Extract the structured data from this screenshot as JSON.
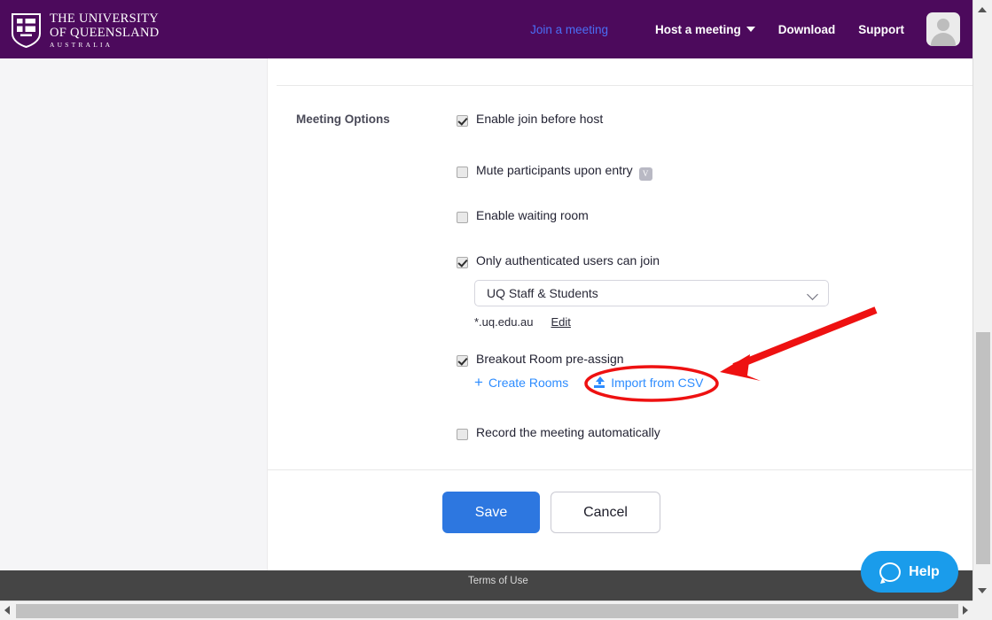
{
  "header": {
    "logo": {
      "line1": "THE UNIVERSITY",
      "line2": "OF QUEENSLAND",
      "line3": "AUSTRALIA",
      "crest_icon": "uq-crest-icon"
    },
    "nav": {
      "join": "Join a meeting",
      "host": "Host a meeting",
      "download": "Download",
      "support": "Support",
      "avatar_icon": "user-avatar-icon"
    },
    "background_color": "#4c0a5c"
  },
  "form": {
    "section_label": "Meeting Options",
    "options": [
      {
        "label": "Enable join before host",
        "checked": true
      },
      {
        "label": "Mute participants upon entry",
        "checked": false,
        "badge": "V"
      },
      {
        "label": "Enable waiting room",
        "checked": false
      },
      {
        "label": "Only authenticated users can join",
        "checked": true
      },
      {
        "label": "Breakout Room pre-assign",
        "checked": true
      },
      {
        "label": "Record the meeting automatically",
        "checked": false
      }
    ],
    "auth_select": {
      "value": "UQ Staff & Students",
      "chevron_icon": "chevron-down-icon"
    },
    "domain": {
      "value": "*.uq.edu.au",
      "edit_label": "Edit"
    },
    "breakout": {
      "create_rooms_label": "Create Rooms",
      "create_rooms_icon": "plus-icon",
      "import_csv_label": "Import from CSV",
      "import_csv_icon": "upload-icon"
    },
    "buttons": {
      "save": "Save",
      "cancel": "Cancel",
      "save_color": "#2d77e0"
    }
  },
  "footer": {
    "terms": "Terms of Use",
    "background_color": "#454545"
  },
  "help_widget": {
    "label": "Help",
    "icon": "chat-bubble-icon",
    "color": "#1a9ceb"
  },
  "annotations": {
    "arrow_color": "#ee1111",
    "ellipse_target": "Import from CSV"
  },
  "scrollbars": {
    "vertical_icon_up": "scroll-up-arrow-icon",
    "vertical_icon_down": "scroll-down-arrow-icon",
    "horizontal_icon_left": "scroll-left-arrow-icon",
    "horizontal_icon_right": "scroll-right-arrow-icon"
  }
}
